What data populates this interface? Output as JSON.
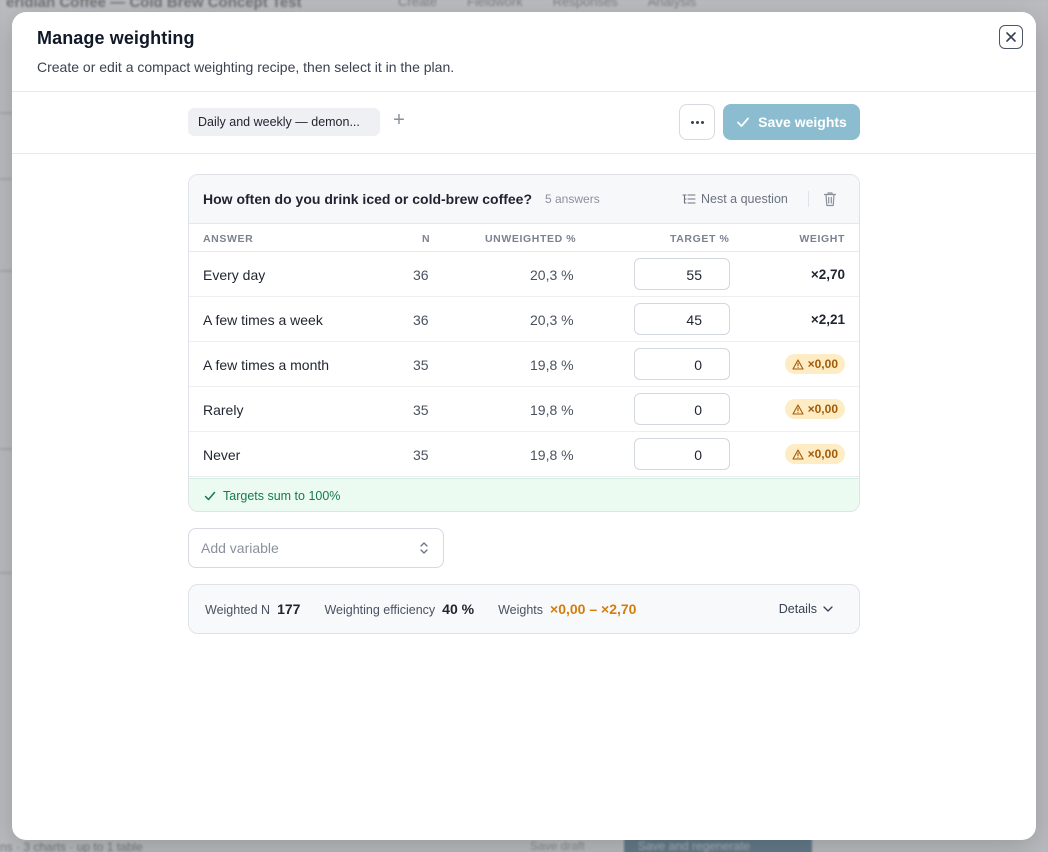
{
  "background": {
    "project_title": "eridian Coffee — Cold Brew Concept Test",
    "tabs": [
      "Create",
      "Fieldwork",
      "Responses",
      "Analysis"
    ],
    "footer_text": "ns · 3 charts · up to 1 table",
    "save_draft": "Save draft",
    "save_regenerate": "Save and regenerate"
  },
  "modal": {
    "title": "Manage weighting",
    "subtitle": "Create or edit a compact weighting recipe, then select it in the plan.",
    "close_icon": "close-icon"
  },
  "toolbar": {
    "recipe_tab_label": "Daily and weekly — demon...",
    "add_recipe_symbol": "+",
    "more_icon": "more-horizontal-icon",
    "save_label": "Save weights"
  },
  "question": {
    "title": "How often do you drink iced or cold-brew coffee?",
    "answer_count": "5 answers",
    "nest_label": "Nest a question",
    "columns": {
      "answer": "ANSWER",
      "n": "N",
      "unweighted": "UNWEIGHTED %",
      "target": "TARGET %",
      "weight": "WEIGHT"
    },
    "rows": [
      {
        "answer": "Every day",
        "n": "36",
        "unweighted": "20,3 %",
        "target": "55",
        "weight": "×2,70",
        "warning": false
      },
      {
        "answer": "A few times a week",
        "n": "36",
        "unweighted": "20,3 %",
        "target": "45",
        "weight": "×2,21",
        "warning": false
      },
      {
        "answer": "A few times a month",
        "n": "35",
        "unweighted": "19,8 %",
        "target": "0",
        "weight": "×0,00",
        "warning": true
      },
      {
        "answer": "Rarely",
        "n": "35",
        "unweighted": "19,8 %",
        "target": "0",
        "weight": "×0,00",
        "warning": true
      },
      {
        "answer": "Never",
        "n": "35",
        "unweighted": "19,8 %",
        "target": "0",
        "weight": "×0,00",
        "warning": true
      }
    ],
    "sum_message": "Targets sum to 100%"
  },
  "add_variable": {
    "placeholder": "Add variable"
  },
  "summary": {
    "weighted_n_label": "Weighted N",
    "weighted_n_value": "177",
    "efficiency_label": "Weighting efficiency",
    "efficiency_value": "40 %",
    "weights_label": "Weights",
    "weights_range": "×0,00 – ×2,70",
    "details_label": "Details"
  },
  "colors": {
    "accent_disabled": "#8bbcd0",
    "success_text": "#167a48",
    "success_bg": "#ecfbf2",
    "warning_text": "#a35a07",
    "warning_bg": "#fdecc4",
    "range_orange": "#d47d0c"
  }
}
